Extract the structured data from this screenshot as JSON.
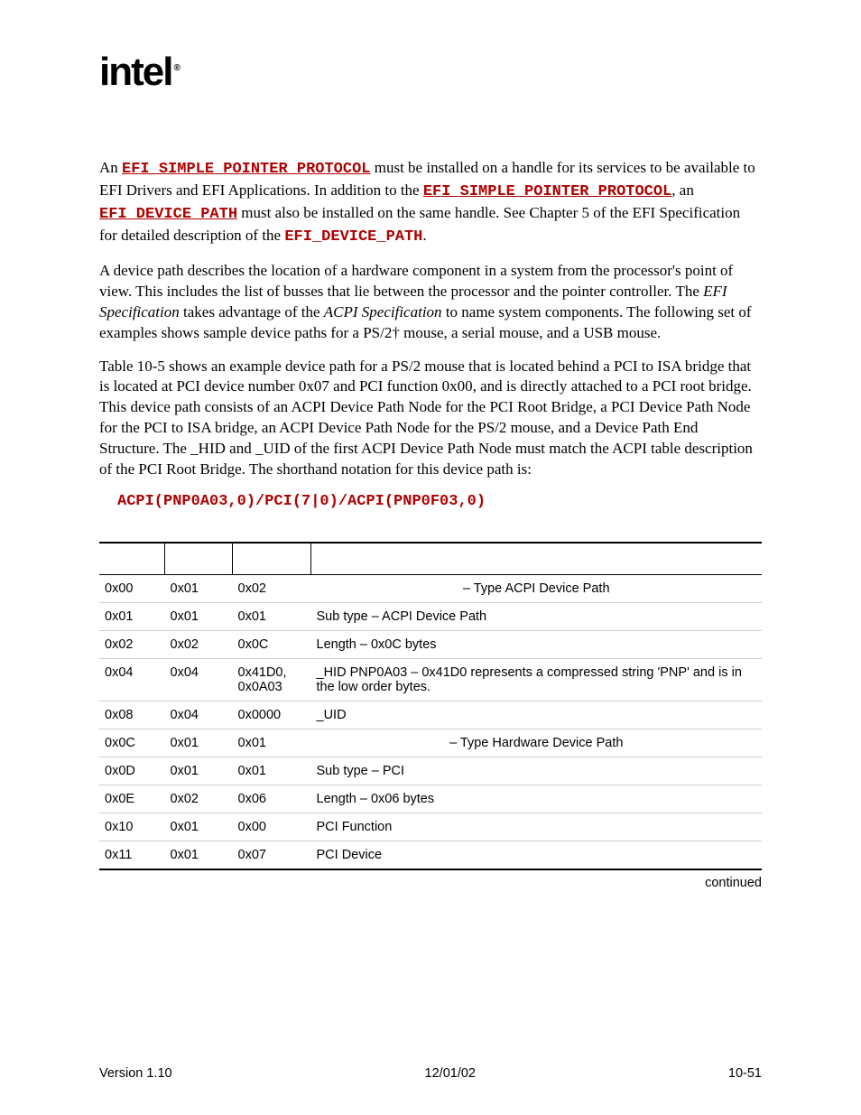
{
  "logo": "intel",
  "logo_reg": "®",
  "para1_a": "An ",
  "para1_efi1": "EFI_SIMPLE_POINTER_PROTOCOL",
  "para1_b": " must be installed on a handle for its services to be available to EFI Drivers and EFI Applications.  In addition to the ",
  "para1_efi2": "EFI_SIMPLE_POINTER_PROTOCOL",
  "para1_c": ", an ",
  "para1_efi3": "EFI_DEVICE_PATH",
  "para1_d": " must also be installed on the same handle.  See Chapter 5 of the EFI Specification for detailed description of the ",
  "para1_efi4": "EFI_DEVICE_PATH",
  "para1_e": ".",
  "para2_a": "A device path describes the location of a hardware component in a system from the processor's point of view.  This includes the list of busses that lie between the processor and the pointer controller.  The ",
  "para2_em1": "EFI Specification",
  "para2_b": " takes advantage of the ",
  "para2_em2": "ACPI Specification",
  "para2_c": " to name system components.  The following set of examples shows sample device paths for a PS/2† mouse, a serial mouse, and a USB mouse.",
  "para3": "Table 10-5 shows an example device path for a PS/2 mouse that is located behind a PCI to ISA bridge that is located at PCI device number 0x07 and PCI function 0x00, and is directly attached to a PCI root bridge.  This device path consists of an ACPI Device Path Node for the PCI Root Bridge, a PCI Device Path Node for the PCI to ISA bridge, an ACPI Device Path Node for the PS/2 mouse, and a Device Path End Structure.  The _HID and _UID of the first ACPI Device Path Node must match the ACPI table description of the PCI Root Bridge.  The shorthand notation for this device path is:",
  "codepath": "ACPI(PNP0A03,0)/PCI(7|0)/ACPI(PNP0F03,0)",
  "table": {
    "headers": [
      "",
      "",
      "",
      ""
    ],
    "rows": [
      {
        "off": "0x00",
        "len": "0x01",
        "val": "0x02",
        "desc": "– Type ACPI Device Path",
        "center": true
      },
      {
        "off": "0x01",
        "len": "0x01",
        "val": "0x01",
        "desc": "Sub type – ACPI Device Path",
        "center": false
      },
      {
        "off": "0x02",
        "len": "0x02",
        "val": "0x0C",
        "desc": "Length – 0x0C bytes",
        "center": false
      },
      {
        "off": "0x04",
        "len": "0x04",
        "val": "0x41D0, 0x0A03",
        "desc": "_HID PNP0A03 – 0x41D0 represents a compressed string 'PNP' and is in the low order bytes.",
        "center": false
      },
      {
        "off": "0x08",
        "len": "0x04",
        "val": "0x0000",
        "desc": "_UID",
        "center": false
      },
      {
        "off": "0x0C",
        "len": "0x01",
        "val": "0x01",
        "desc": "– Type Hardware Device Path",
        "center": true
      },
      {
        "off": "0x0D",
        "len": "0x01",
        "val": "0x01",
        "desc": "Sub type – PCI",
        "center": false
      },
      {
        "off": "0x0E",
        "len": "0x02",
        "val": "0x06",
        "desc": "Length – 0x06 bytes",
        "center": false
      },
      {
        "off": "0x10",
        "len": "0x01",
        "val": "0x00",
        "desc": "PCI Function",
        "center": false
      },
      {
        "off": "0x11",
        "len": "0x01",
        "val": "0x07",
        "desc": "PCI Device",
        "center": false
      }
    ],
    "continued": "continued"
  },
  "footer": {
    "left": "Version 1.10",
    "center": "12/01/02",
    "right": "10-51"
  }
}
